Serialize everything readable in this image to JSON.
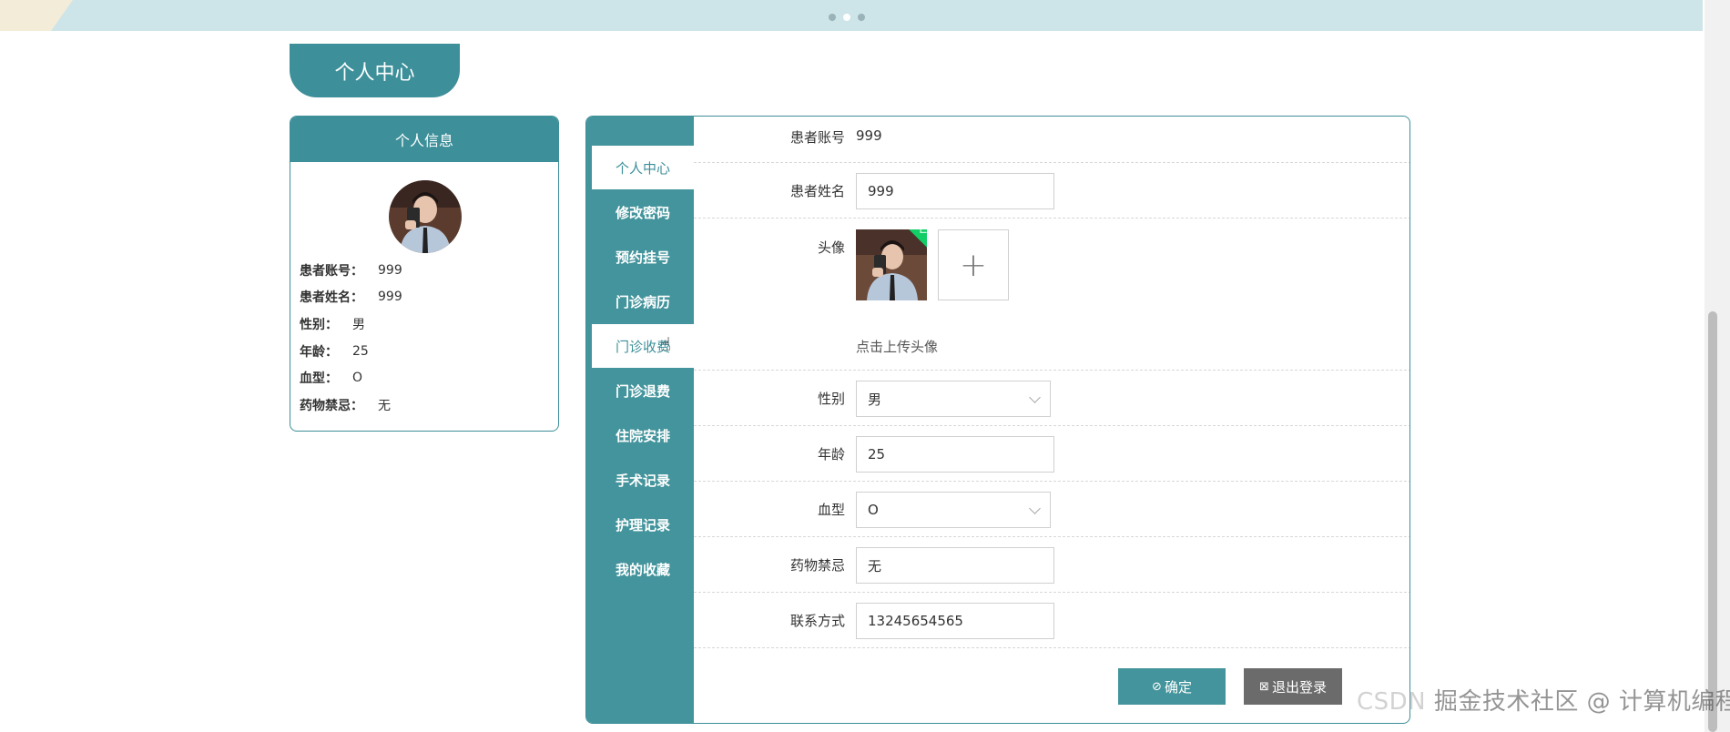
{
  "page_title": "个人中心",
  "info_card": {
    "header": "个人信息",
    "rows": [
      {
        "label": "患者账号：",
        "value": "999"
      },
      {
        "label": "患者姓名：",
        "value": "999"
      },
      {
        "label": "性别：",
        "value": "男"
      },
      {
        "label": "年龄：",
        "value": "25"
      },
      {
        "label": "血型：",
        "value": "O"
      },
      {
        "label": "药物禁忌：",
        "value": "无"
      }
    ]
  },
  "nav": {
    "items": [
      {
        "label": "个人中心",
        "state": "active"
      },
      {
        "label": "修改密码"
      },
      {
        "label": "预约挂号"
      },
      {
        "label": "门诊病历"
      },
      {
        "label": "门诊收费",
        "state": "hover"
      },
      {
        "label": "门诊退费"
      },
      {
        "label": "住院安排"
      },
      {
        "label": "手术记录"
      },
      {
        "label": "护理记录"
      },
      {
        "label": "我的收藏"
      }
    ]
  },
  "form": {
    "account_label": "患者账号",
    "account_value": "999",
    "name_label": "患者姓名",
    "name_value": "999",
    "avatar_label": "头像",
    "upload_hint": "点击上传头像",
    "upload_plus": "+",
    "gender_label": "性别",
    "gender_value": "男",
    "age_label": "年龄",
    "age_value": "25",
    "blood_label": "血型",
    "blood_value": "O",
    "drug_label": "药物禁忌",
    "drug_value": "无",
    "contact_label": "联系方式",
    "contact_value": "13245654565"
  },
  "buttons": {
    "confirm_icon": "⊘",
    "confirm_label": "确定",
    "logout_icon": "⊠",
    "logout_label": "退出登录"
  },
  "watermark": {
    "dim": "CSDN ",
    "text": "掘金技术社区 @ 计算机编程果茶熊"
  },
  "colors": {
    "primary": "#3d8f99",
    "nav_bg": "#43949c",
    "logout_bg": "#6b6b6b",
    "success": "#13ce66"
  }
}
